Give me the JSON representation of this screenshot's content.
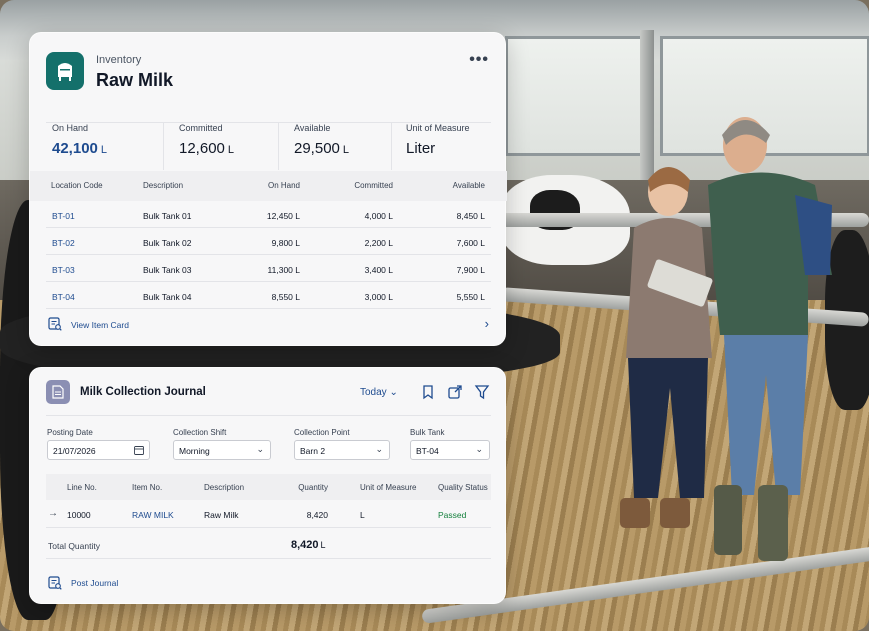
{
  "inventory": {
    "subtitle": "Inventory",
    "title": "Raw Milk",
    "stats": [
      {
        "label": "On Hand",
        "value": "42,100",
        "unit": "L"
      },
      {
        "label": "Committed",
        "value": "12,600",
        "unit": "L"
      },
      {
        "label": "Available",
        "value": "29,500",
        "unit": "L"
      },
      {
        "label": "Unit of Measure",
        "value": "Liter"
      }
    ],
    "columns": [
      "Location Code",
      "Description",
      "On Hand",
      "Committed",
      "Available"
    ],
    "rows": [
      {
        "code": "BT-01",
        "description": "Bulk Tank 01",
        "on_hand": "12,450 L",
        "committed": "4,000 L",
        "available": "8,450 L"
      },
      {
        "code": "BT-02",
        "description": "Bulk Tank 02",
        "on_hand": "9,800 L",
        "committed": "2,200 L",
        "available": "7,600 L"
      },
      {
        "code": "BT-03",
        "description": "Bulk Tank 03",
        "on_hand": "11,300 L",
        "committed": "3,400 L",
        "available": "7,900 L"
      },
      {
        "code": "BT-04",
        "description": "Bulk Tank 04",
        "on_hand": "8,550 L",
        "committed": "3,000 L",
        "available": "5,550 L"
      }
    ],
    "footer_link": "View Item Card",
    "icons": {
      "app": "silo-icon",
      "more": "more-icon",
      "card": "item-card-icon",
      "chevron": "chevron-right-icon"
    },
    "accent_color": "#14706b",
    "link_color": "#1e4b8f"
  },
  "journal": {
    "title": "Milk Collection Journal",
    "period_filter": "Today",
    "fields": [
      {
        "label": "Posting Date",
        "value": "21/07/2026"
      },
      {
        "label": "Collection Shift",
        "value": "Morning"
      },
      {
        "label": "Collection Point",
        "value": "Barn 2"
      },
      {
        "label": "Bulk Tank",
        "value": "BT-04"
      }
    ],
    "columns": [
      "Line No.",
      "Item No.",
      "Description",
      "Quantity",
      "Unit of Measure",
      "Quality Status"
    ],
    "lines": [
      {
        "line_no": "10000",
        "item_no": "RAW MILK",
        "description": "Raw Milk",
        "quantity": "8,420",
        "uom": "L",
        "quality": "Passed"
      }
    ],
    "total_label": "Total Quantity",
    "total_value": "8,420",
    "total_unit": "L",
    "post_label": "Post Journal",
    "icons": {
      "doc": "document-icon",
      "bookmark": "bookmark-icon",
      "share": "share-icon",
      "filter": "filter-icon",
      "calendar": "calendar-icon",
      "row_arrow": "arrow-right-icon",
      "post": "post-journal-icon"
    },
    "status_color": "#15803d"
  }
}
